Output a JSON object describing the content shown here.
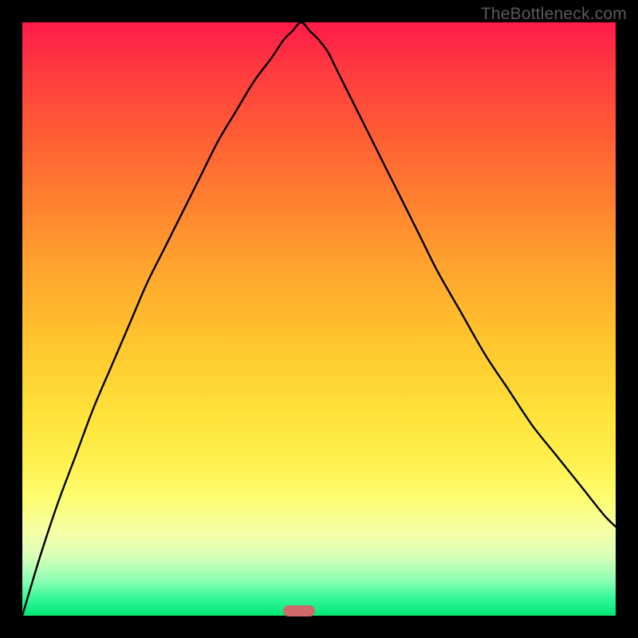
{
  "watermark": {
    "text": "TheBottleneck.com"
  },
  "colors": {
    "frame": "#000000",
    "marker": "#cf6a6a",
    "curve": "#000000",
    "gradient_top": "#ff1a4a",
    "gradient_bottom": "#00e876"
  },
  "chart_data": {
    "type": "line",
    "title": "",
    "xlabel": "",
    "ylabel": "",
    "xlim": [
      0,
      100
    ],
    "ylim": [
      0,
      100
    ],
    "annotations": [
      "TheBottleneck.com"
    ],
    "series": [
      {
        "name": "bottleneck-curve",
        "x": [
          0,
          3,
          6,
          9,
          12,
          15,
          18,
          21,
          24,
          27,
          30,
          33,
          36,
          39,
          42,
          44,
          45.5,
          47,
          48.5,
          50,
          51.5,
          53,
          55,
          58,
          61,
          64,
          67,
          70,
          74,
          78,
          82,
          86,
          90,
          94,
          98,
          100
        ],
        "y": [
          0,
          10,
          19,
          27,
          35,
          42,
          49,
          56,
          62,
          68,
          74,
          80,
          85,
          90,
          94,
          97,
          98.5,
          100,
          98.5,
          97,
          95,
          92,
          88,
          82,
          76,
          70,
          64,
          58,
          51,
          44,
          38,
          32,
          27,
          22,
          17,
          15
        ]
      }
    ],
    "marker": {
      "x_center": 47,
      "width_pct": 5.3,
      "color": "#cf6a6a"
    }
  }
}
